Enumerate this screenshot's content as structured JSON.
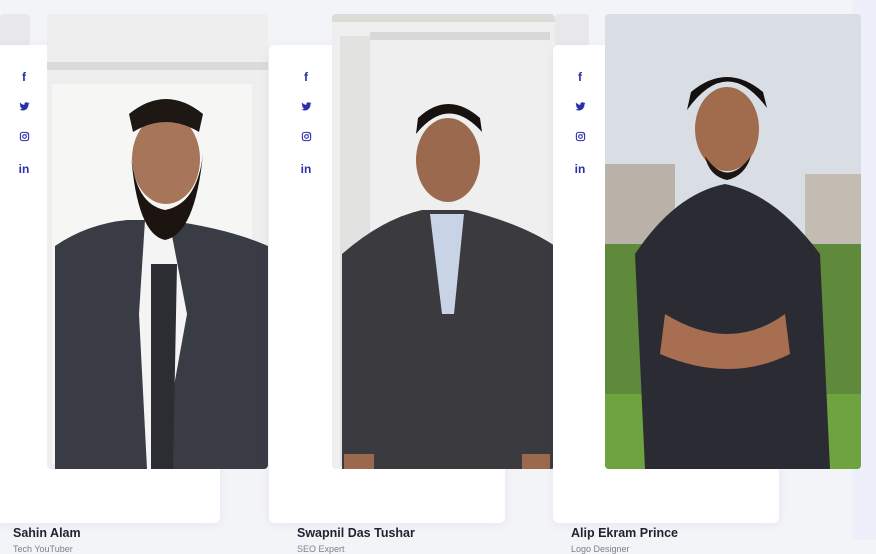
{
  "team": {
    "members": [
      {
        "name": "Sahin Alam",
        "role": "Tech YouTuber",
        "social": [
          "f",
          "twitter",
          "instagram",
          "in"
        ]
      },
      {
        "name": "Swapnil Das Tushar",
        "role": "SEO Expert",
        "social": [
          "f",
          "twitter",
          "instagram",
          "in"
        ]
      },
      {
        "name": "Alip Ekram Prince",
        "role": "Logo Designer",
        "social": [
          "f",
          "twitter",
          "instagram",
          "in"
        ]
      }
    ]
  },
  "icons": {
    "facebook": "f",
    "twitter": "twitter-bird-icon",
    "instagram": "instagram-icon",
    "linkedin": "in"
  },
  "colors": {
    "social_icon": "#2b2fa8",
    "name_text": "#1f2230",
    "role_text": "#7c7f8c"
  }
}
